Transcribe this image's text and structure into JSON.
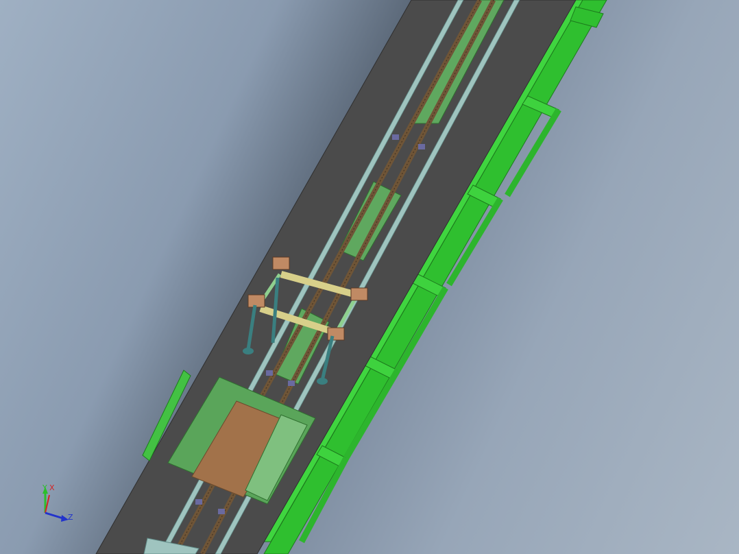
{
  "app": {
    "name": ""
  },
  "viewport": {
    "triad": {
      "axis_y_label": "Y",
      "axis_x_label": "X",
      "axis_z_label": "Z",
      "colors": {
        "y": "#2bbf2b",
        "x": "#d42424",
        "z": "#2233cc"
      }
    },
    "model_colors": {
      "frame_green": "#33cc33",
      "frame_green_dark": "#1f8f1f",
      "deck_gray": "#4a4a4a",
      "rail_teal": "#9fc4bf",
      "screw_brown": "#7a5a3a",
      "wood_panel": "#a2724a",
      "plate_green": "#5ea85e"
    }
  }
}
